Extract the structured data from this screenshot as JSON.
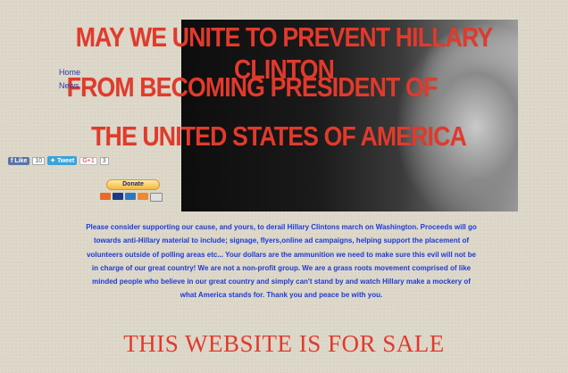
{
  "headline": {
    "line1": "MAY WE UNITE TO PREVENT HILLARY CLINTON",
    "line2": "FROM BECOMING PRESIDENT OF",
    "line3": "THE UNITED STATES OF AMERICA"
  },
  "nav": {
    "items": [
      "Home",
      "News"
    ]
  },
  "social": {
    "like_label": "Like",
    "like_count": "10",
    "tweet_label": "Tweet",
    "gplus_label": "G+1",
    "gplus_count": "3"
  },
  "donate": {
    "label": "Donate"
  },
  "body_text": "Please consider supporting our cause, and yours, to derail Hillary Clintons march on Washington. Proceeds will go towards anti-Hillary material to include; signage, flyers,online ad campaigns, helping support the placement of  volunteers outside of polling areas etc... Your dollars are the ammunition we need to make sure this evil will not be in charge of our great country! We are not a non-profit group. We are a grass roots movement comprised of like minded people who believe in our great country and simply can't stand by and watch Hillary make a mockery of what America stands for. Thank you and peace be with you.",
  "sale_banner": "THIS WEBSITE IS FOR SALE",
  "colors": {
    "headline": "#e13a2c",
    "body_text": "#1f3bd4",
    "background": "#ddd8c9"
  }
}
